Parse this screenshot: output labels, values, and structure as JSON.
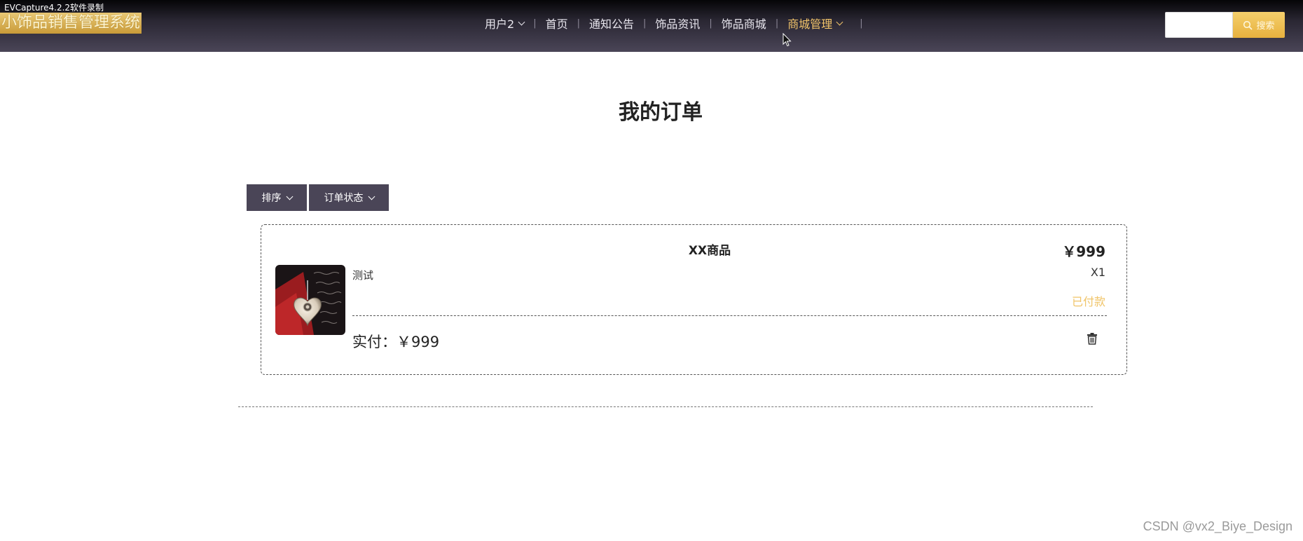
{
  "recorder_watermark": "EVCapture4.2.2软件录制",
  "header": {
    "site_title": "小饰品销售管理系统",
    "nav": [
      {
        "label": "用户2",
        "has_dropdown": true
      },
      {
        "label": "首页"
      },
      {
        "label": "通知公告"
      },
      {
        "label": "饰品资讯"
      },
      {
        "label": "饰品商城"
      },
      {
        "label": "商城管理",
        "has_dropdown": true,
        "active": true
      }
    ],
    "search": {
      "placeholder": "",
      "button_label": "搜索"
    }
  },
  "page": {
    "title": "我的订单",
    "filters": {
      "sort_label": "排序",
      "status_label": "订单状态"
    }
  },
  "order": {
    "product_name": "XX商品",
    "price": "￥999",
    "description": "测试",
    "quantity": "X1",
    "status": "已付款",
    "paid_label": "实付：￥999"
  },
  "footer": {
    "watermark": "CSDN @vx2_Biye_Design"
  },
  "colors": {
    "header_bg": "#4a4557",
    "accent_gold": "#f2c46a",
    "filter_bg": "#4a4557"
  },
  "icons": {
    "search": "search-icon",
    "delete": "trash-icon",
    "dropdown": "chevron-down-icon"
  }
}
